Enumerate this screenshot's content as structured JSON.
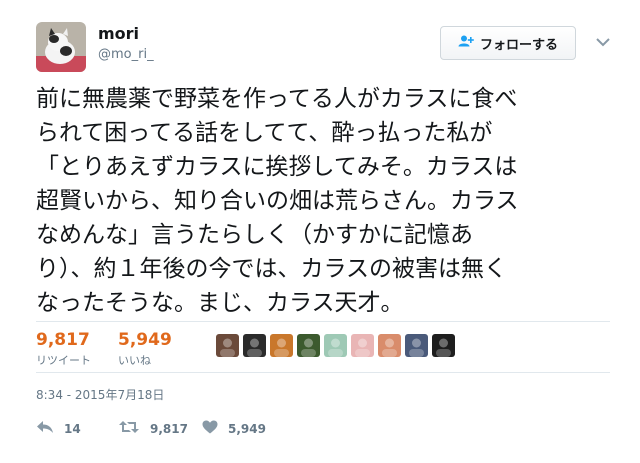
{
  "user": {
    "display_name": "mori",
    "handle": "@mo_ri_",
    "avatar_icon": "cat-photo-avatar"
  },
  "follow_button": {
    "label": "フォローする",
    "icon": "add-user-icon"
  },
  "more_menu_icon": "chevron-down-icon",
  "tweet": {
    "lines": [
      "前に無農薬で野菜を作ってる人がカラスに食べ",
      "られて困ってる話をしてて、酔っ払った私が",
      "「とりあえずカラスに挨拶してみそ。カラスは",
      "超賢いから、知り合いの畑は荒らさん。カラス",
      "なめんな」言うたらしく（かすかに記憶あ",
      "り）、約１年後の今では、カラスの被害は無く",
      "なったそうな。まじ、カラス天才。"
    ]
  },
  "stats": {
    "retweets": {
      "count": "9,817",
      "label": "リツイート"
    },
    "likes": {
      "count": "5,949",
      "label": "いいね"
    }
  },
  "likers": [
    {
      "icon": "liker-avatar-1",
      "color": "#6b4a3a"
    },
    {
      "icon": "liker-avatar-2",
      "color": "#2b2b2b"
    },
    {
      "icon": "liker-avatar-3",
      "color": "#c9772b"
    },
    {
      "icon": "liker-avatar-4",
      "color": "#3c5a2e"
    },
    {
      "icon": "liker-avatar-5",
      "color": "#9ec9b5"
    },
    {
      "icon": "liker-avatar-6",
      "color": "#e9b5b5"
    },
    {
      "icon": "liker-avatar-7",
      "color": "#d98c6b"
    },
    {
      "icon": "liker-avatar-8",
      "color": "#4a5a7a"
    },
    {
      "icon": "liker-avatar-9",
      "color": "#1e1e1e"
    }
  ],
  "timestamp": "8:34 - 2015年7月18日",
  "actions": {
    "reply": {
      "icon": "reply-icon",
      "count": "14"
    },
    "retweet": {
      "icon": "retweet-icon",
      "count": "9,817"
    },
    "like": {
      "icon": "heart-icon",
      "count": "5,949"
    }
  },
  "colors": {
    "stat_accent": "#e0691c",
    "muted": "#657786",
    "text": "#14171a",
    "divider": "#e1e8ed"
  }
}
